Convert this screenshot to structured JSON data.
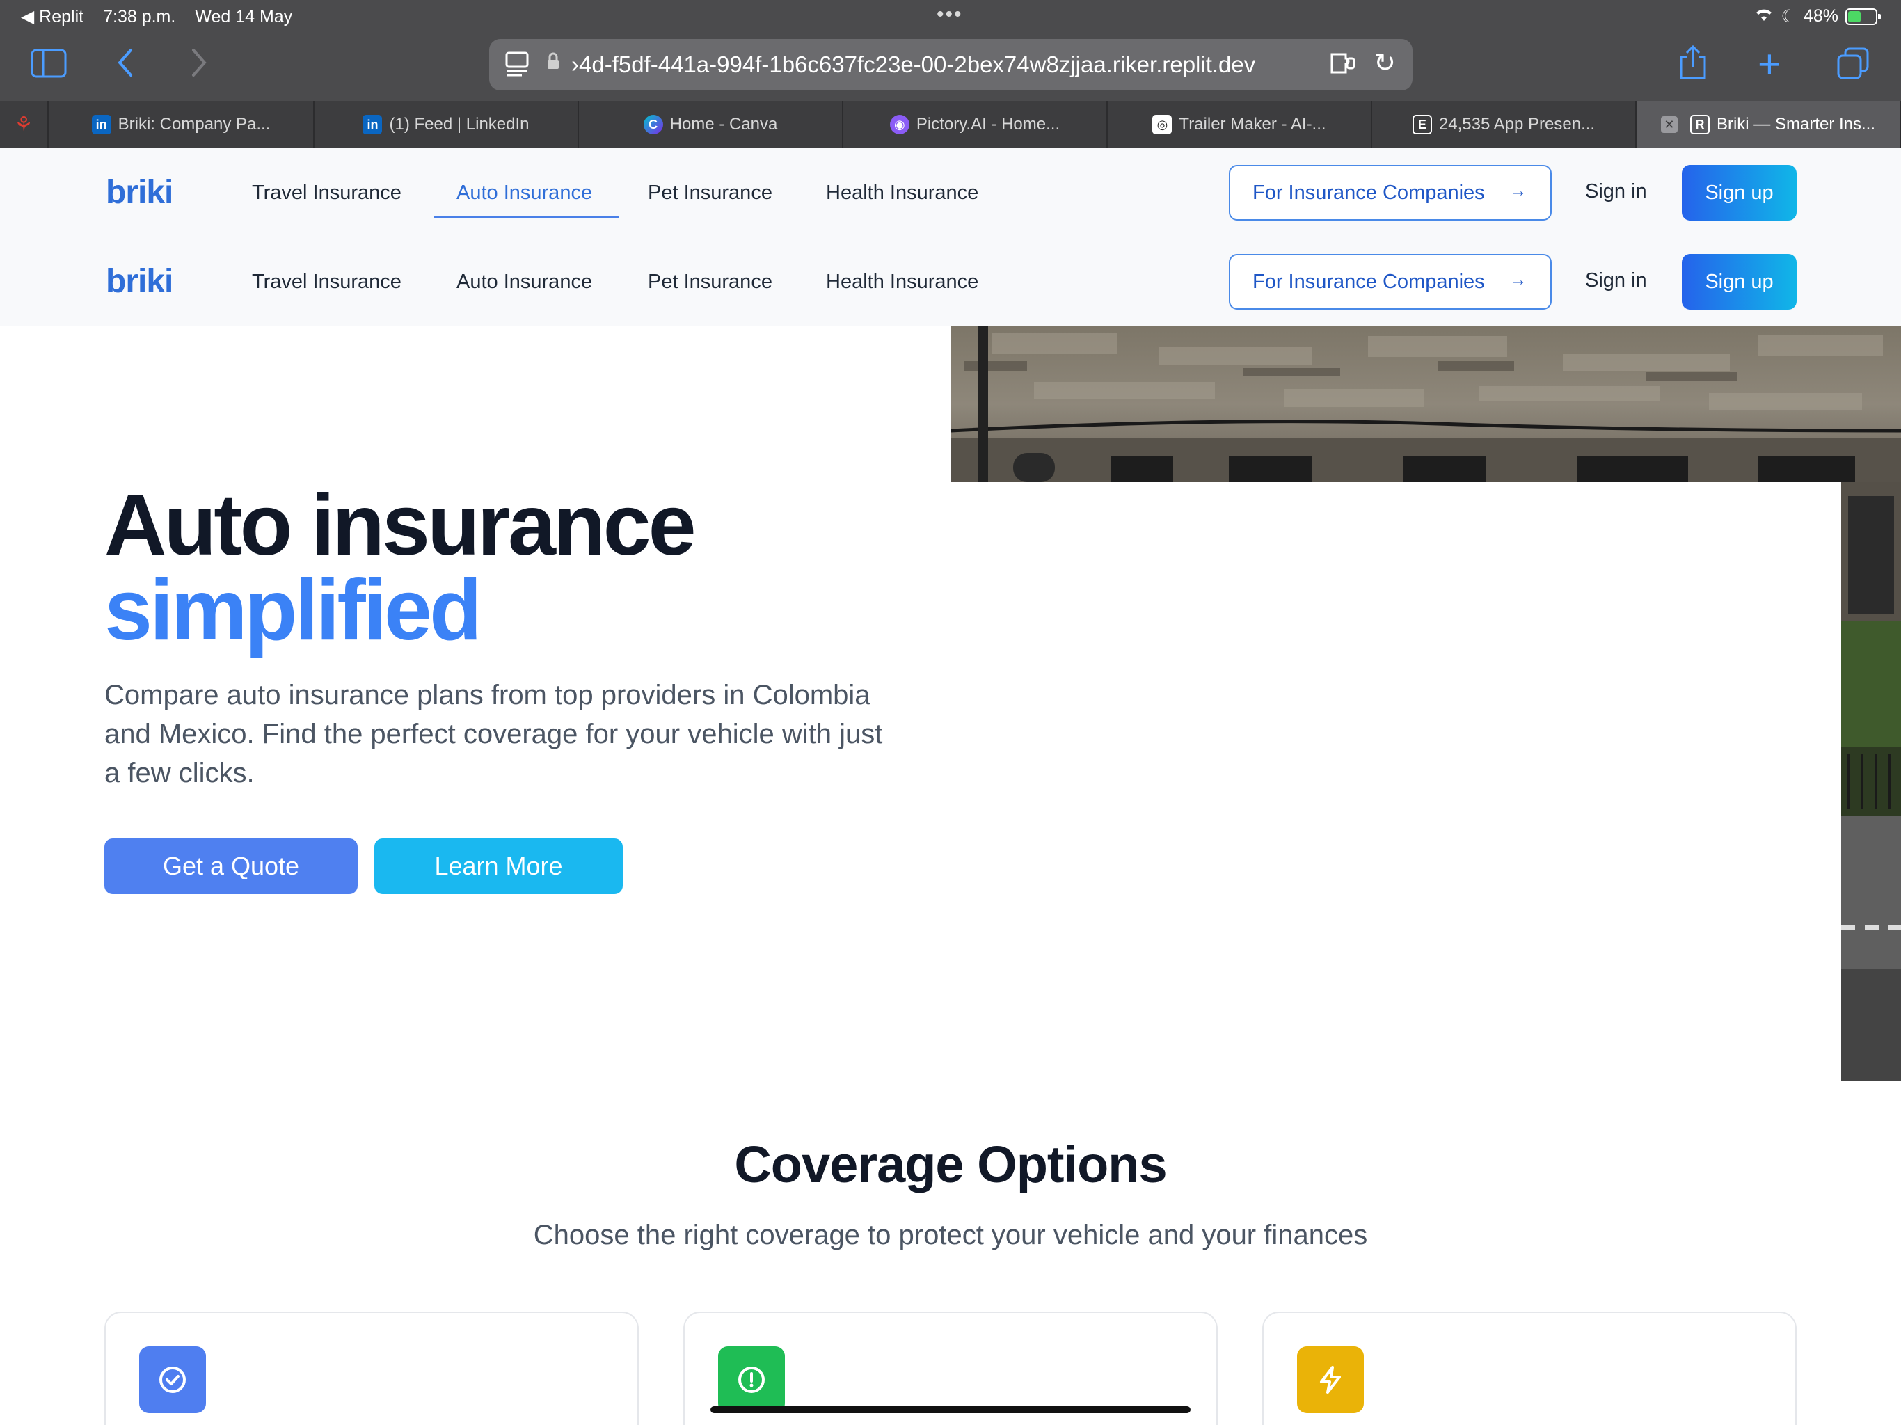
{
  "status_bar": {
    "back_app": "◀ Replit",
    "time": "7:38 p.m.",
    "date": "Wed 14 May",
    "battery": "48%",
    "battery_level": 0.48
  },
  "browser": {
    "url": "›4d-f5df-441a-994f-1b6c637fc23e-00-2bex74w8zjjaa.riker.replit.dev",
    "tabs": [
      {
        "label": "Briki: Company Pa...",
        "icon": "linkedin-icon",
        "color": "#0a66c2",
        "glyph": "in"
      },
      {
        "label": "(1) Feed | LinkedIn",
        "icon": "linkedin-icon",
        "color": "#0a66c2",
        "glyph": "in"
      },
      {
        "label": "Home - Canva",
        "icon": "canva-icon",
        "color": "#7d2ae8",
        "glyph": "C"
      },
      {
        "label": "Pictory.AI - Home...",
        "icon": "pictory-icon",
        "color": "#8b5cf6",
        "glyph": "◉"
      },
      {
        "label": "Trailer Maker - AI-...",
        "icon": "trailer-maker-icon",
        "color": "#222222",
        "glyph": "◎"
      },
      {
        "label": "24,535 App Presen...",
        "icon": "envato-icon",
        "color": "#222222",
        "glyph": "E"
      },
      {
        "label": "Briki — Smarter Ins...",
        "icon": "replit-icon",
        "color": "#222222",
        "glyph": "R"
      }
    ]
  },
  "site": {
    "logo": "briki",
    "nav": [
      "Travel Insurance",
      "Auto Insurance",
      "Pet Insurance",
      "Health Insurance"
    ],
    "active_nav": "Auto Insurance",
    "for_companies": "For Insurance Companies",
    "arrow": "→",
    "sign_in": "Sign in",
    "sign_up": "Sign up"
  },
  "hero": {
    "title_line1": "Auto insurance",
    "title_line2": "simplified",
    "subtitle": "Compare auto insurance plans from top providers in Colombia and Mexico. Find the perfect coverage for your vehicle with just a few clicks.",
    "btn_quote": "Get a Quote",
    "btn_learn": "Learn More"
  },
  "coverage": {
    "title": "Coverage Options",
    "subtitle": "Choose the right coverage to protect your vehicle and your finances",
    "cards": [
      {
        "icon": "check-circle-icon",
        "color": "#4f7ef0"
      },
      {
        "icon": "alert-circle-icon",
        "color": "#1fbd55"
      },
      {
        "icon": "lightning-icon",
        "color": "#eab308"
      }
    ]
  }
}
